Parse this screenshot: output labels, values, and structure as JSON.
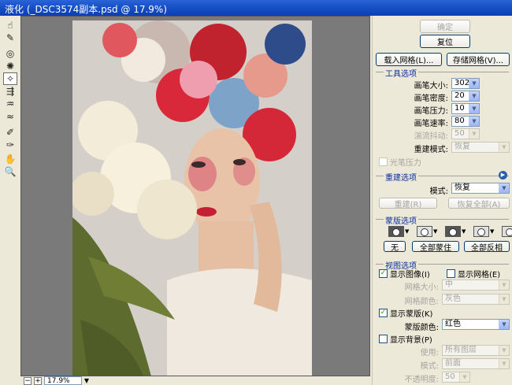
{
  "window": {
    "title": "液化 (_DSC3574副本.psd @ 17.9%)"
  },
  "tools": [
    "forward-warp-icon",
    "reconstruct-icon",
    "twirl-icon",
    "pucker-icon",
    "bloat-icon",
    "push-left-icon",
    "mirror-icon",
    "turbulence-icon",
    "freeze-mask-icon",
    "thaw-mask-icon",
    "hand-icon",
    "zoom-icon"
  ],
  "buttons": {
    "ok": "确定",
    "reset": "复位",
    "load_mesh": "载入网格(L)...",
    "save_mesh": "存储网格(V)..."
  },
  "tool_options": {
    "title": "工具选项",
    "brush_size_label": "画笔大小:",
    "brush_size": "302",
    "brush_density_label": "画笔密度:",
    "brush_density": "20",
    "brush_pressure_label": "画笔压力:",
    "brush_pressure": "10",
    "brush_rate_label": "画笔速率:",
    "brush_rate": "80",
    "turbulent_jitter_label": "湍流抖动:",
    "turbulent_jitter": "50",
    "reconstruct_mode_label": "重建模式:",
    "reconstruct_mode": "恢复",
    "stylus_pressure_label": "光笔压力"
  },
  "reconstruct_options": {
    "title": "重建选项",
    "mode_label": "模式:",
    "mode": "恢复",
    "reconstruct_button": "重建(R)",
    "restore_all_button": "恢复全部(A)"
  },
  "mask_options": {
    "title": "蒙版选项",
    "none": "无",
    "mask_all": "全部蒙住",
    "invert_all": "全部反相"
  },
  "view_options": {
    "title": "视图选项",
    "show_image_label": "显示图像(I)",
    "show_image_checked": true,
    "show_mesh_label": "显示网格(E)",
    "show_mesh_checked": false,
    "mesh_size_label": "网格大小:",
    "mesh_size": "中",
    "mesh_color_label": "网格颜色:",
    "mesh_color": "灰色",
    "show_mask_label": "显示蒙版(K)",
    "show_mask_checked": true,
    "mask_color_label": "蒙版颜色:",
    "mask_color": "红色",
    "show_backdrop_label": "显示背景(P)",
    "show_backdrop_checked": false,
    "use_label": "使用:",
    "use": "所有图层",
    "mode_label": "模式:",
    "mode": "前面",
    "opacity_label": "不透明度:",
    "opacity": "50"
  },
  "status": {
    "zoom": "17.9%",
    "zoom_out": "−",
    "zoom_in": "+"
  }
}
